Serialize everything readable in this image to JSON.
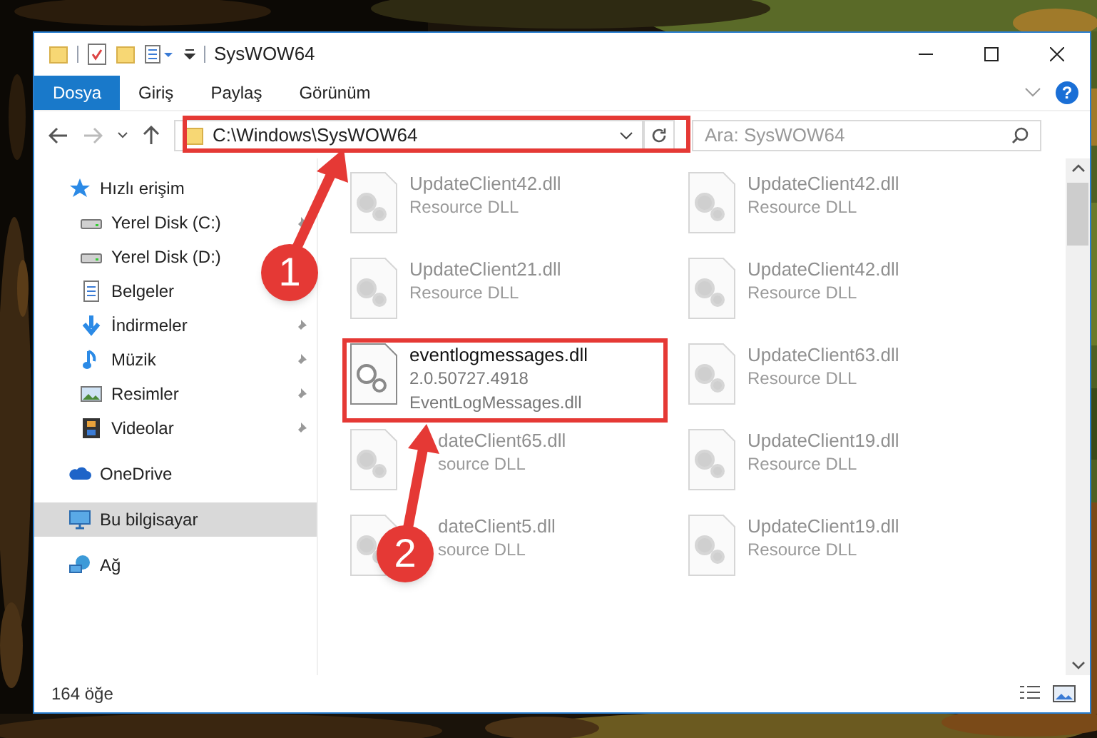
{
  "window": {
    "title": "SysWOW64"
  },
  "ribbon": {
    "tabs": [
      {
        "label": "Dosya",
        "selected": true
      },
      {
        "label": "Giriş",
        "selected": false
      },
      {
        "label": "Paylaş",
        "selected": false
      },
      {
        "label": "Görünüm",
        "selected": false
      }
    ],
    "help": "?"
  },
  "address_bar": {
    "path": "C:\\Windows\\SysWOW64",
    "search_placeholder": "Ara: SysWOW64"
  },
  "sidebar": {
    "items": [
      {
        "label": "Hızlı erişim",
        "kind": "star",
        "pinned": false,
        "selected": false,
        "group": true
      },
      {
        "label": "Yerel Disk (C:)",
        "kind": "drive",
        "pinned": true,
        "selected": false,
        "group": false
      },
      {
        "label": "Yerel Disk (D:)",
        "kind": "drive",
        "pinned": false,
        "selected": false,
        "group": false
      },
      {
        "label": "Belgeler",
        "kind": "document",
        "pinned": false,
        "selected": false,
        "group": false
      },
      {
        "label": "İndirmeler",
        "kind": "download",
        "pinned": true,
        "selected": false,
        "group": false
      },
      {
        "label": "Müzik",
        "kind": "music",
        "pinned": true,
        "selected": false,
        "group": false
      },
      {
        "label": "Resimler",
        "kind": "pictures",
        "pinned": true,
        "selected": false,
        "group": false
      },
      {
        "label": "Videolar",
        "kind": "video",
        "pinned": true,
        "selected": false,
        "group": false
      },
      {
        "label": "OneDrive",
        "kind": "cloud",
        "pinned": false,
        "selected": false,
        "group": true
      },
      {
        "label": "Bu bilgisayar",
        "kind": "computer",
        "pinned": false,
        "selected": true,
        "group": true
      },
      {
        "label": "Ağ",
        "kind": "network",
        "pinned": false,
        "selected": false,
        "group": true
      }
    ]
  },
  "files": [
    {
      "name": "UpdateClient42.dll",
      "lines": [
        "Resource DLL"
      ],
      "faded": true
    },
    {
      "name": "UpdateClient42.dll",
      "lines": [
        "Resource DLL"
      ],
      "faded": true
    },
    {
      "name": "UpdateClient21.dll",
      "lines": [
        "Resource DLL"
      ],
      "faded": true
    },
    {
      "name": "UpdateClient42.dll",
      "lines": [
        "Resource DLL"
      ],
      "faded": true
    },
    {
      "name": "eventlogmessages.dll",
      "lines": [
        "2.0.50727.4918",
        "EventLogMessages.dll"
      ],
      "faded": false
    },
    {
      "name": "UpdateClient63.dll",
      "lines": [
        "Resource DLL"
      ],
      "faded": true
    },
    {
      "name": "dateClient65.dll",
      "lines": [
        "source DLL"
      ],
      "faded": true,
      "partial": true
    },
    {
      "name": "UpdateClient19.dll",
      "lines": [
        "Resource DLL"
      ],
      "faded": true
    },
    {
      "name": "dateClient5.dll",
      "lines": [
        "source DLL"
      ],
      "faded": true,
      "partial": true
    },
    {
      "name": "UpdateClient19.dll",
      "lines": [
        "Resource DLL"
      ],
      "faded": true
    }
  ],
  "status_bar": {
    "count": "164 öğe"
  },
  "callouts": [
    {
      "label": "1"
    },
    {
      "label": "2"
    }
  ]
}
